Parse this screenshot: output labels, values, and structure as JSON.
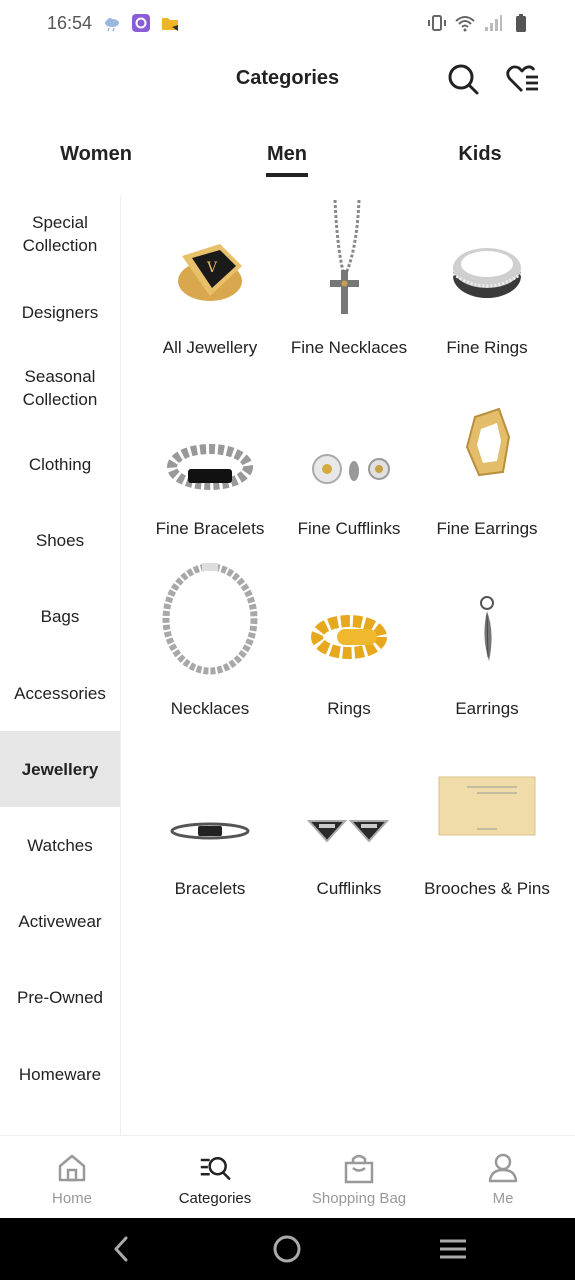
{
  "status_bar": {
    "time": "16:54",
    "left_icons": [
      "cloud-icon",
      "app-icon",
      "folder-icon"
    ],
    "right_icons": [
      "vibrate-icon",
      "wifi-icon",
      "signal-icon",
      "battery-icon"
    ]
  },
  "header": {
    "title": "Categories",
    "search_icon": "search-icon",
    "wishlist_icon": "heart-list-icon"
  },
  "tabs": [
    {
      "label": "Women",
      "active": false
    },
    {
      "label": "Men",
      "active": true
    },
    {
      "label": "Kids",
      "active": false
    }
  ],
  "sidebar": {
    "items": [
      {
        "label": "Special Collection"
      },
      {
        "label": "Designers"
      },
      {
        "label": "Seasonal Collection"
      },
      {
        "label": "Clothing"
      },
      {
        "label": "Shoes"
      },
      {
        "label": "Bags"
      },
      {
        "label": "Accessories"
      },
      {
        "label": "Jewellery",
        "active": true
      },
      {
        "label": "Watches"
      },
      {
        "label": "Activewear"
      },
      {
        "label": "Pre-Owned"
      },
      {
        "label": "Homeware"
      }
    ]
  },
  "grid": {
    "items": [
      {
        "label": "All Jewellery",
        "image": "signet-ring"
      },
      {
        "label": "Fine Necklaces",
        "image": "cross-necklace"
      },
      {
        "label": "Fine Rings",
        "image": "band-ring"
      },
      {
        "label": "Fine Bracelets",
        "image": "chain-bracelet"
      },
      {
        "label": "Fine Cufflinks",
        "image": "cufflinks"
      },
      {
        "label": "Fine Earrings",
        "image": "hoop-earring"
      },
      {
        "label": "Necklaces",
        "image": "chain-necklace"
      },
      {
        "label": "Rings",
        "image": "bead-ring"
      },
      {
        "label": "Earrings",
        "image": "feather-earring"
      },
      {
        "label": "Bracelets",
        "image": "cord-bracelet"
      },
      {
        "label": "Cufflinks",
        "image": "triangle-cufflinks"
      },
      {
        "label": "Brooches & Pins",
        "image": "card-pin"
      }
    ]
  },
  "bottom_nav": [
    {
      "label": "Home",
      "icon": "home-icon",
      "active": false
    },
    {
      "label": "Categories",
      "icon": "categories-icon",
      "active": true
    },
    {
      "label": "Shopping Bag",
      "icon": "bag-icon",
      "active": false
    },
    {
      "label": "Me",
      "icon": "user-icon",
      "active": false
    }
  ],
  "system_nav": [
    "back-icon",
    "home-circle-icon",
    "recents-icon"
  ]
}
